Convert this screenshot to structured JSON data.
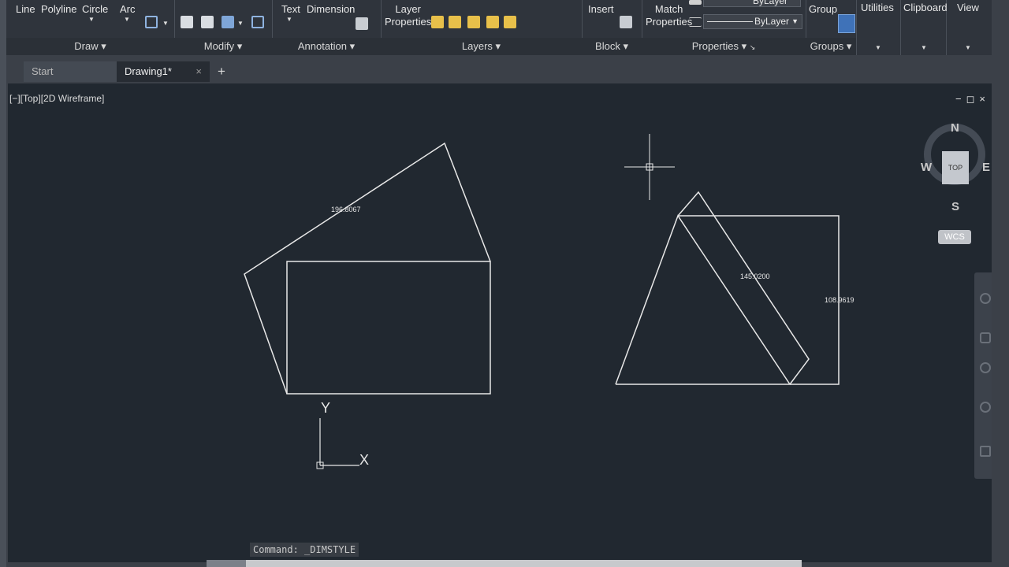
{
  "ribbon": {
    "draw": {
      "line": "Line",
      "polyline": "Polyline",
      "circle": "Circle",
      "arc": "Arc",
      "title": "Draw"
    },
    "modify": {
      "title": "Modify"
    },
    "annotation": {
      "text": "Text",
      "dimension": "Dimension",
      "title": "Annotation"
    },
    "layers": {
      "layer_properties_line1": "Layer",
      "layer_properties_line2": "Properties",
      "title": "Layers"
    },
    "block": {
      "insert": "Insert",
      "title": "Block"
    },
    "properties": {
      "match_line1": "Match",
      "match_line2": "Properties",
      "bylayer_top": "ByLayer",
      "bylayer": "ByLayer",
      "title": "Properties"
    },
    "groups": {
      "group": "Group",
      "title": "Groups"
    },
    "utilities": "Utilities",
    "clipboard": "Clipboard",
    "view": "View"
  },
  "tabs": {
    "start": "Start",
    "drawing": "Drawing1*",
    "close": "×",
    "add": "+"
  },
  "viewport": {
    "label": "[−][Top][2D Wireframe]",
    "controls": "−◻×",
    "dimensions": {
      "left_aligned": "196.8067",
      "right_aligned": "145.0200",
      "right_vertical": "108.9619"
    },
    "ucs": {
      "x": "X",
      "y": "Y"
    }
  },
  "viewcube": {
    "n": "N",
    "s": "S",
    "e": "E",
    "w": "W",
    "face": "TOP",
    "wcs": "WCS"
  },
  "command": {
    "history": "Command: _DIMSTYLE"
  },
  "colors": {
    "ribbon_bg": "#2f343c",
    "canvas_bg": "#212830",
    "geometry": "#e8e8e8",
    "accent": "#3f72b8"
  }
}
